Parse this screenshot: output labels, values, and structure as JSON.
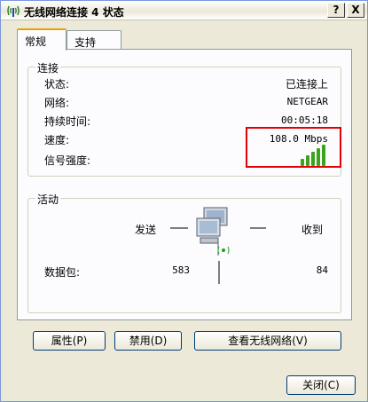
{
  "window": {
    "title": "无线网络连接 4 状态",
    "help_label": "?",
    "close_label": "X"
  },
  "tabs": [
    {
      "label": "常规"
    },
    {
      "label": "支持"
    }
  ],
  "connection": {
    "legend": "连接",
    "rows": [
      {
        "label": "状态:",
        "value": "已连接上"
      },
      {
        "label": "网络:",
        "value": "NETGEAR"
      },
      {
        "label": "持续时间:",
        "value": "00:05:18"
      },
      {
        "label": "速度:",
        "value": "108.0 Mbps"
      },
      {
        "label": "信号强度:",
        "value": ""
      }
    ],
    "signal_bars_filled": 5,
    "signal_bars_total": 5,
    "signal_color": "#3aa41a"
  },
  "activity": {
    "legend": "活动",
    "sent_label": "发送",
    "received_label": "收到",
    "packets_label": "数据包:",
    "packets_sent": "583",
    "packets_received": "84"
  },
  "buttons": {
    "properties": "属性(P)",
    "disable": "禁用(D)",
    "view_networks": "查看无线网络(V)",
    "close": "关闭(C)"
  },
  "highlight_color": "#e20000"
}
